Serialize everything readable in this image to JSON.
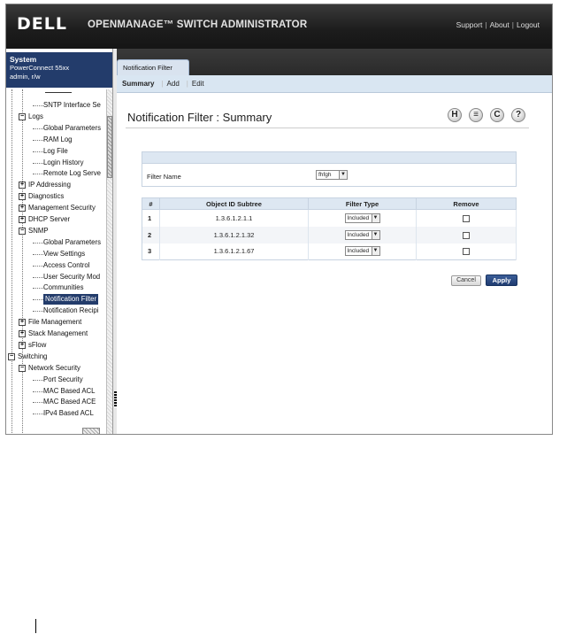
{
  "header": {
    "logo": "DELL",
    "title": "OPENMANAGE™ SWITCH ADMINISTRATOR",
    "links": [
      "Support",
      "About",
      "Logout"
    ]
  },
  "system": {
    "title": "System",
    "model": "PowerConnect 55xx",
    "user": "admin, r/w"
  },
  "tree": [
    {
      "label": "SNTP Interface Se",
      "indent": 3,
      "type": "leaf"
    },
    {
      "label": "Logs",
      "indent": 2,
      "type": "minus"
    },
    {
      "label": "Global Parameters",
      "indent": 3,
      "type": "leaf"
    },
    {
      "label": "RAM Log",
      "indent": 3,
      "type": "leaf"
    },
    {
      "label": "Log File",
      "indent": 3,
      "type": "leaf"
    },
    {
      "label": "Login History",
      "indent": 3,
      "type": "leaf"
    },
    {
      "label": "Remote Log Serve",
      "indent": 3,
      "type": "leaf"
    },
    {
      "label": "IP Addressing",
      "indent": 2,
      "type": "plus"
    },
    {
      "label": "Diagnostics",
      "indent": 2,
      "type": "plus"
    },
    {
      "label": "Management Security",
      "indent": 2,
      "type": "plus"
    },
    {
      "label": "DHCP Server",
      "indent": 2,
      "type": "plus"
    },
    {
      "label": "SNMP",
      "indent": 2,
      "type": "minus"
    },
    {
      "label": "Global Parameters",
      "indent": 3,
      "type": "leaf"
    },
    {
      "label": "View Settings",
      "indent": 3,
      "type": "leaf"
    },
    {
      "label": "Access Control",
      "indent": 3,
      "type": "leaf"
    },
    {
      "label": "User Security Mod",
      "indent": 3,
      "type": "leaf"
    },
    {
      "label": "Communities",
      "indent": 3,
      "type": "leaf"
    },
    {
      "label": "Notification Filter",
      "indent": 3,
      "type": "leaf",
      "selected": true
    },
    {
      "label": "Notification Recipi",
      "indent": 3,
      "type": "leaf"
    },
    {
      "label": "File Management",
      "indent": 2,
      "type": "plus"
    },
    {
      "label": "Stack Management",
      "indent": 2,
      "type": "plus"
    },
    {
      "label": "sFlow",
      "indent": 2,
      "type": "plus"
    },
    {
      "label": "Switching",
      "indent": 1,
      "type": "minus"
    },
    {
      "label": "Network Security",
      "indent": 2,
      "type": "minus"
    },
    {
      "label": "Port Security",
      "indent": 3,
      "type": "leaf"
    },
    {
      "label": "MAC Based ACL",
      "indent": 3,
      "type": "leaf"
    },
    {
      "label": "MAC Based ACE",
      "indent": 3,
      "type": "leaf"
    },
    {
      "label": "IPv4 Based ACL",
      "indent": 3,
      "type": "leaf"
    }
  ],
  "tab": {
    "label": "Notification Filter"
  },
  "subnav": [
    "Summary",
    "Add",
    "Edit"
  ],
  "page": {
    "title": "Notification Filter : Summary"
  },
  "toolbar_icons": [
    {
      "name": "help-icon",
      "glyph": "H"
    },
    {
      "name": "print-icon",
      "glyph": "≡"
    },
    {
      "name": "refresh-icon",
      "glyph": "C"
    },
    {
      "name": "question-icon",
      "glyph": "?"
    }
  ],
  "filter": {
    "label": "Filter Name",
    "value": "fhfgh"
  },
  "table": {
    "headers": [
      "#",
      "Object ID Subtree",
      "Filter Type",
      "Remove"
    ],
    "rows": [
      {
        "num": "1",
        "oid": "1.3.6.1.2.1.1",
        "type": "Included"
      },
      {
        "num": "2",
        "oid": "1.3.6.1.2.1.32",
        "type": "Included"
      },
      {
        "num": "3",
        "oid": "1.3.6.1.2.1.67",
        "type": "Included"
      }
    ]
  },
  "buttons": {
    "cancel": "Cancel",
    "apply": "Apply"
  },
  "colors": {
    "nav_dark": "#233c6b",
    "header_bg": "#1c1c1c",
    "subnav_bg": "#d9e6f2",
    "apply_blue": "#1f3b70"
  }
}
